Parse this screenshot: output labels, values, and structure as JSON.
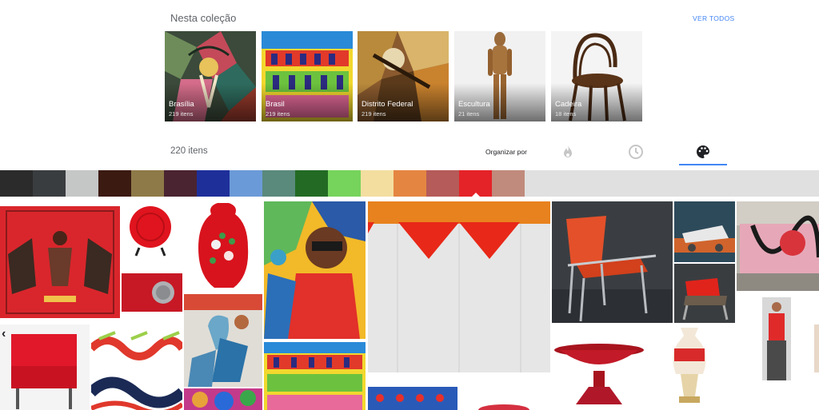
{
  "collection": {
    "title": "Nesta coleção",
    "see_all": "VER TODOS",
    "cards": [
      {
        "name": "Brasília",
        "count": "219 itens"
      },
      {
        "name": "Brasil",
        "count": "219 itens"
      },
      {
        "name": "Distrito Federal",
        "count": "219 itens"
      },
      {
        "name": "Escultura",
        "count": "21 itens"
      },
      {
        "name": "Cadeira",
        "count": "18 itens"
      }
    ]
  },
  "results": {
    "count": "220 itens",
    "sort_label": "Organizar por",
    "sort_icons": [
      "flame-icon",
      "clock-icon",
      "palette-icon"
    ]
  },
  "palette": {
    "colors": [
      "#2b2b2b",
      "#3a3d3f",
      "#c5c6c6",
      "#3b1a12",
      "#8e7a48",
      "#4a2430",
      "#1f2f9a",
      "#6b9ad8",
      "#5a8a7c",
      "#236b25",
      "#76d35c",
      "#f3dea0",
      "#e48642",
      "#b55b59",
      "#e42328",
      "#c08b7c"
    ],
    "selected_index": 14
  },
  "nav": {
    "prev_label": "‹"
  }
}
